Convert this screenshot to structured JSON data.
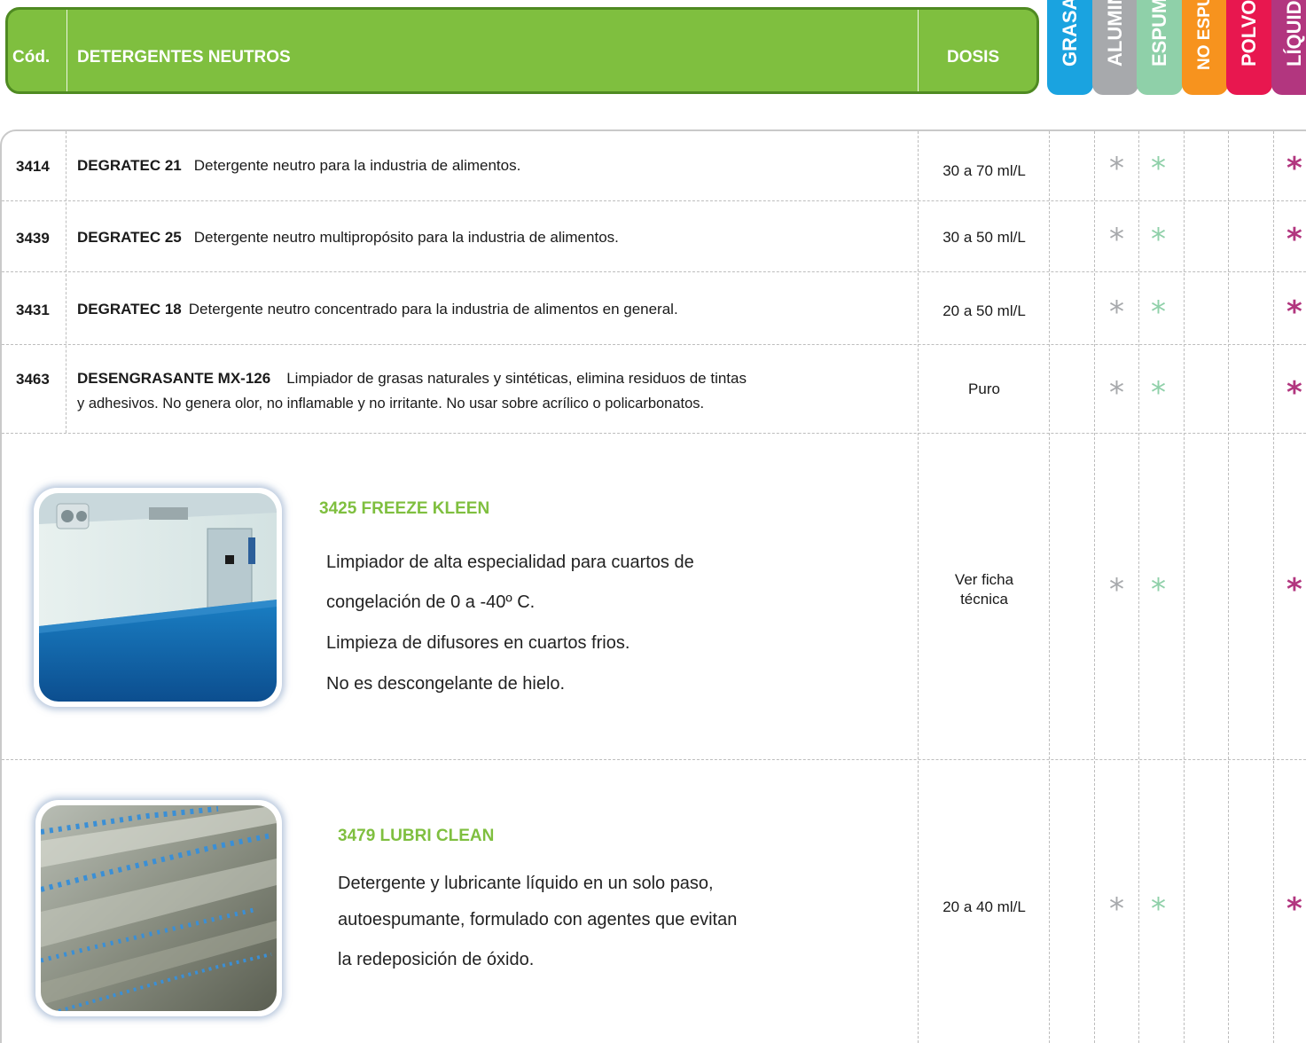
{
  "header": {
    "code_label": "Cód.",
    "title": "DETERGENTES NEUTROS",
    "dose_label": "DOSIS"
  },
  "categories": [
    {
      "label": "GRASAS",
      "color": "#1aa3e0"
    },
    {
      "label": "ALUMINIO",
      "color": "#a7a9ac"
    },
    {
      "label": "ESPUMA",
      "color": "#8fd0a9"
    },
    {
      "label": "NO ESPUMA",
      "color": "#f7931e"
    },
    {
      "label": "POLVO",
      "color": "#e8174f"
    },
    {
      "label": "LÍQUIDO",
      "color": "#b2367f"
    }
  ],
  "colors": {
    "header_green": "#7fbf3f",
    "star_gray": "#a7a9ac",
    "star_mint": "#8fd0a9",
    "star_magenta": "#b2367f"
  },
  "products": [
    {
      "code": "3414",
      "name": "DEGRATEC 21",
      "description": "Detergente neutro para la industria de alimentos.",
      "description_line2": "",
      "dose": "30 a 70 ml/L"
    },
    {
      "code": "3439",
      "name": "DEGRATEC  25",
      "description": "Detergente neutro multipropósito para la industria de alimentos.",
      "description_line2": "",
      "dose": "30 a 50 ml/L"
    },
    {
      "code": "3431",
      "name": "DEGRATEC 18",
      "description": "Detergente neutro concentrado para la industria de alimentos en general.",
      "description_line2": "",
      "dose": "20 a 50 ml/L"
    },
    {
      "code": "3463",
      "name": "DESENGRASANTE MX-126",
      "description": "Limpiador de grasas naturales y sintéticas, elimina residuos de tintas",
      "description_line2": "y  adhesivos.  No genera  olor, no inflamable y no irritante. No usar sobre acrílico o policarbonatos.",
      "dose": "Puro"
    }
  ],
  "featured": [
    {
      "title": "3425  FREEZE KLEEN",
      "lines": [
        "Limpiador de alta especialidad para cuartos de",
        "congelación de 0 a -40º C.",
        "Limpieza de difusores en cuartos frios.",
        "No es descongelante de hielo."
      ],
      "dose_line1": "Ver ficha",
      "dose_line2": "técnica"
    },
    {
      "title": "3479  LUBRI CLEAN",
      "lines": [
        "Detergente y lubricante líquido en un solo paso,",
        "autoespumante,  formulado con agentes que evitan",
        "la redeposición de óxido."
      ],
      "dose_line1": "20 a 40 ml/L",
      "dose_line2": ""
    }
  ],
  "star_glyph": "*"
}
